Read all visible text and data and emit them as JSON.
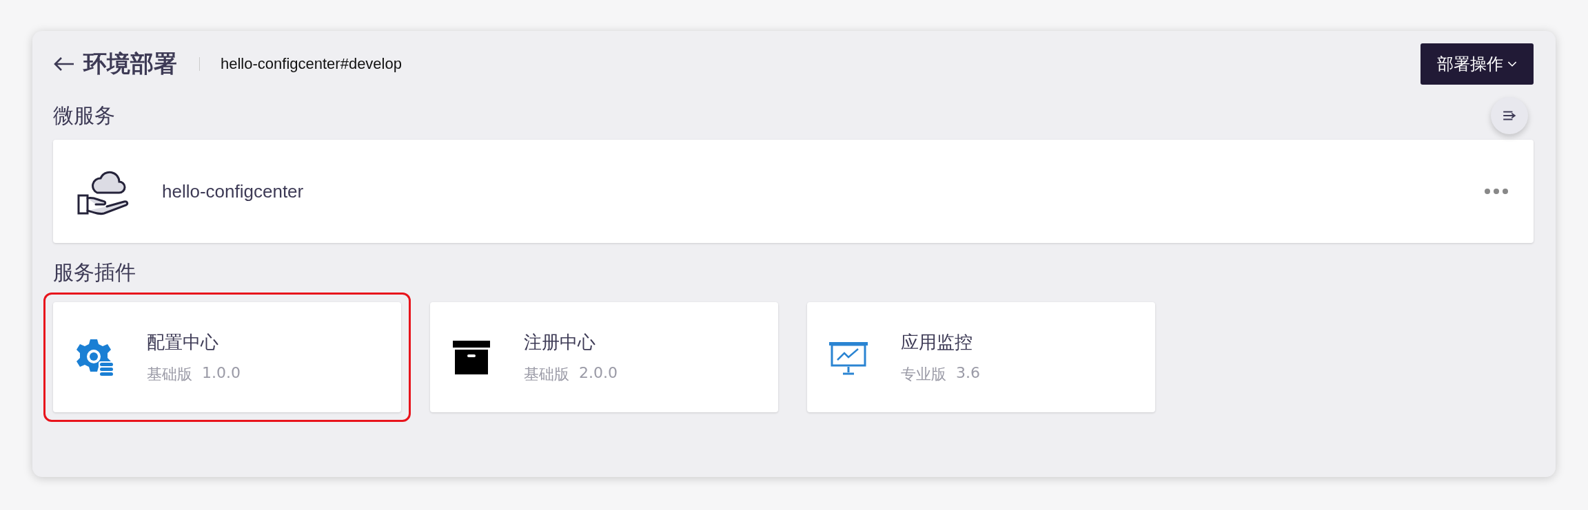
{
  "header": {
    "title": "环境部署",
    "breadcrumb": "hello-configcenter#develop",
    "action_button": "部署操作"
  },
  "microservices": {
    "heading": "微服务",
    "items": [
      {
        "name": "hello-configcenter"
      }
    ]
  },
  "plugins": {
    "heading": "服务插件",
    "items": [
      {
        "kind": "config",
        "name": "配置中心",
        "edition": "基础版",
        "version": "1.0.0",
        "highlighted": true
      },
      {
        "kind": "registry",
        "name": "注册中心",
        "edition": "基础版",
        "version": "2.0.0",
        "highlighted": false
      },
      {
        "kind": "monitor",
        "name": "应用监控",
        "edition": "专业版",
        "version": "3.6",
        "highlighted": false
      }
    ]
  }
}
